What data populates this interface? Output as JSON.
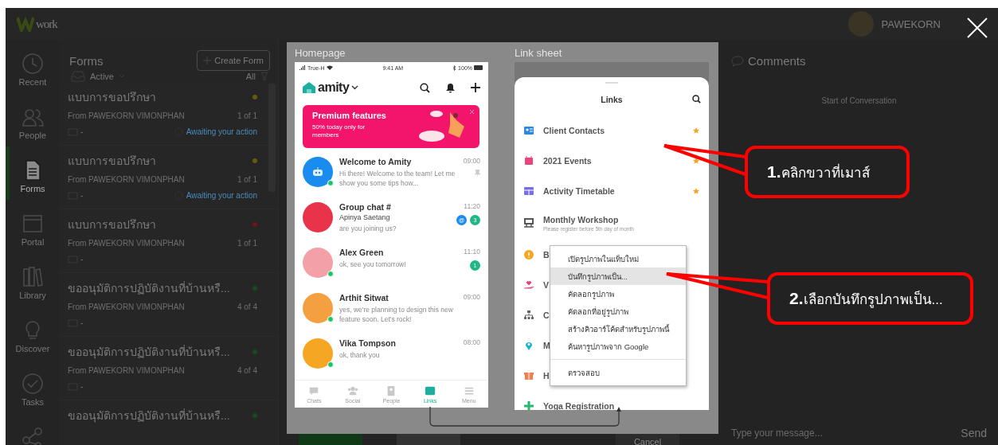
{
  "header": {
    "logo": "work",
    "user": "PAWEKORN"
  },
  "nav_rail": {
    "items": [
      {
        "label": "Recent",
        "kind": "clock",
        "selected": false
      },
      {
        "label": "People",
        "kind": "people",
        "selected": false
      },
      {
        "label": "Forms",
        "kind": "doc",
        "selected": true
      },
      {
        "label": "Portal",
        "kind": "window",
        "selected": false
      },
      {
        "label": "Library",
        "kind": "books",
        "selected": false
      },
      {
        "label": "Discover",
        "kind": "bulb",
        "selected": false
      },
      {
        "label": "Tasks",
        "kind": "check",
        "selected": false
      },
      {
        "kind": "share",
        "selected": false
      }
    ]
  },
  "forms_panel": {
    "title": "Forms",
    "create_button": "Create Form",
    "filter": "Active",
    "scope": "All",
    "items": [
      {
        "title": "แบบการขอปรึกษา",
        "from": "From PAWEKORN VIMONPHAN",
        "count": "1 of 1",
        "color": "#6b5810",
        "date": "-",
        "status": "Awaiting your action"
      },
      {
        "title": "แบบการขอปรึกษา",
        "from": "From PAWEKORN VIMONPHAN",
        "count": "1 of 1",
        "color": "#6b5810",
        "date": "-",
        "status": "Awaiting your action"
      },
      {
        "title": "แบบการขอปรึกษา",
        "from": "From PAWEKORN VIMONPHAN",
        "count": "1 of 1",
        "color": "#6b1818",
        "date": "-"
      },
      {
        "title": "ขออนุมัติการปฏิบัติงานที่บ้านหรื...",
        "from": "From PAWEKORN VIMONPHAN",
        "count": "4 of 4",
        "color": "#104d1c",
        "date": "-"
      },
      {
        "title": "ขออนุมัติการปฏิบัติงานที่บ้านหรื...",
        "from": "From PAWEKORN VIMONPHAN",
        "count": "4 of 4",
        "color": "#104d1c",
        "date": "-"
      },
      {
        "title": "ขออนุมัติการปฏิบัติงานที่บ้านหรื...",
        "color": "#104d1c"
      }
    ]
  },
  "action_buttons": [
    {
      "kind": "primary"
    },
    {
      "kind": "secondary"
    },
    {
      "kind": "plain",
      "label": "Cancel"
    }
  ],
  "comments": {
    "title": "Comments",
    "empty_note": "Start of Conversation",
    "input": {
      "placeholder": "Type your message..."
    },
    "send": "Send"
  },
  "home_screen": {
    "label": "Homepage",
    "status_bar": {
      "carrier": "True-H",
      "time": "9:41 AM",
      "battery": "100%"
    },
    "app_name": "amity",
    "banner": {
      "title": "Premium features",
      "text": "50% today only for members"
    },
    "chats": [
      {
        "name": "Welcome to Amity",
        "message": "Hi there! Welcome to the team! Let me show you some tips how...",
        "time": "09:00",
        "kind": "bot",
        "color": "#1a8cf0",
        "online": true,
        "pinned": true
      },
      {
        "name": "Group chat #",
        "sender": "Apinya Saetang",
        "message": "are you joining us?",
        "time": "11:20",
        "kind": "photo",
        "color": "#e8334a",
        "online": false,
        "pinned": false,
        "badges": [
          {
            "kind": "mention",
            "text": "@"
          },
          {
            "kind": "count",
            "text": "3"
          }
        ]
      },
      {
        "name": "Alex Green",
        "message": "ok, see you tomorrow!",
        "time": "11:10",
        "kind": "photo",
        "color": "#f3a0a8",
        "online": true,
        "pinned": false,
        "badges": [
          {
            "kind": "count",
            "text": "1"
          }
        ]
      },
      {
        "name": "Arthit Sitwat",
        "message": "yes, we're planning to design this new feature soon. Let's rock!",
        "time": "09:00",
        "kind": "photo",
        "color": "#f5a040",
        "online": true,
        "pinned": false
      },
      {
        "name": "Vika Tompson",
        "message": "ok, thank you",
        "time": "08:00",
        "kind": "photo",
        "color": "#f5a623",
        "online": true,
        "pinned": false
      }
    ],
    "tabs": [
      {
        "label": "Chats",
        "kind": "chat",
        "selected": false
      },
      {
        "label": "Social",
        "kind": "social",
        "selected": false
      },
      {
        "label": "People",
        "kind": "people",
        "selected": false
      },
      {
        "label": "Links",
        "kind": "links",
        "selected": true
      },
      {
        "label": "Menu",
        "kind": "menu",
        "selected": false
      }
    ]
  },
  "link_sheet": {
    "label": "Link sheet",
    "title": "Links",
    "items": [
      {
        "label": "Client Contacts",
        "kind": "contact",
        "color": "#2b8ae0",
        "starred": true
      },
      {
        "label": "2021 Events",
        "kind": "calendar",
        "color": "#e8457c",
        "starred": true
      },
      {
        "label": "Activity Timetable",
        "kind": "table",
        "color": "#7a6fe0",
        "starred": true
      },
      {
        "label": "Monthly Workshop",
        "note": "Please register before 5th day of month",
        "kind": "presentation",
        "color": "#555555",
        "starred": false
      },
      {
        "label": "B",
        "kind": "info",
        "color": "#f5a623",
        "starred": false
      },
      {
        "label": "V",
        "kind": "heart",
        "color": "#e8457c",
        "starred": false
      },
      {
        "label": "C",
        "kind": "org",
        "color": "#666666",
        "starred": false
      },
      {
        "label": "M",
        "kind": "pin",
        "color": "#18b4c8",
        "starred": false
      },
      {
        "label": "H",
        "kind": "gift",
        "color": "#f08050",
        "starred": false
      },
      {
        "label": "Yoga Registration",
        "kind": "plus",
        "color": "#2bb673",
        "starred": false
      }
    ]
  },
  "context_menu": {
    "items": [
      {
        "kind": "item",
        "label": "เปิดรูปภาพในแท็บใหม่",
        "selected": false
      },
      {
        "kind": "item",
        "label": "บันทึกรูปภาพเป็น...",
        "selected": true
      },
      {
        "kind": "item",
        "label": "คัดลอกรูปภาพ",
        "selected": false
      },
      {
        "kind": "item",
        "label": "คัดลอกที่อยู่รูปภาพ",
        "selected": false
      },
      {
        "kind": "item",
        "label": "สร้างคิวอาร์โค้ดสำหรับรูปภาพนี้",
        "selected": false
      },
      {
        "kind": "item",
        "label": "ค้นหารูปภาพจาก Google",
        "selected": false
      },
      {
        "kind": "separator"
      },
      {
        "kind": "item",
        "label": "ตรวจสอบ",
        "selected": false
      }
    ]
  },
  "callouts": [
    {
      "text": "**1.**คลิกขวาที่เมาส์"
    },
    {
      "text": "**2.**เลือกบันทึกรูปภาพเป็น..."
    }
  ]
}
